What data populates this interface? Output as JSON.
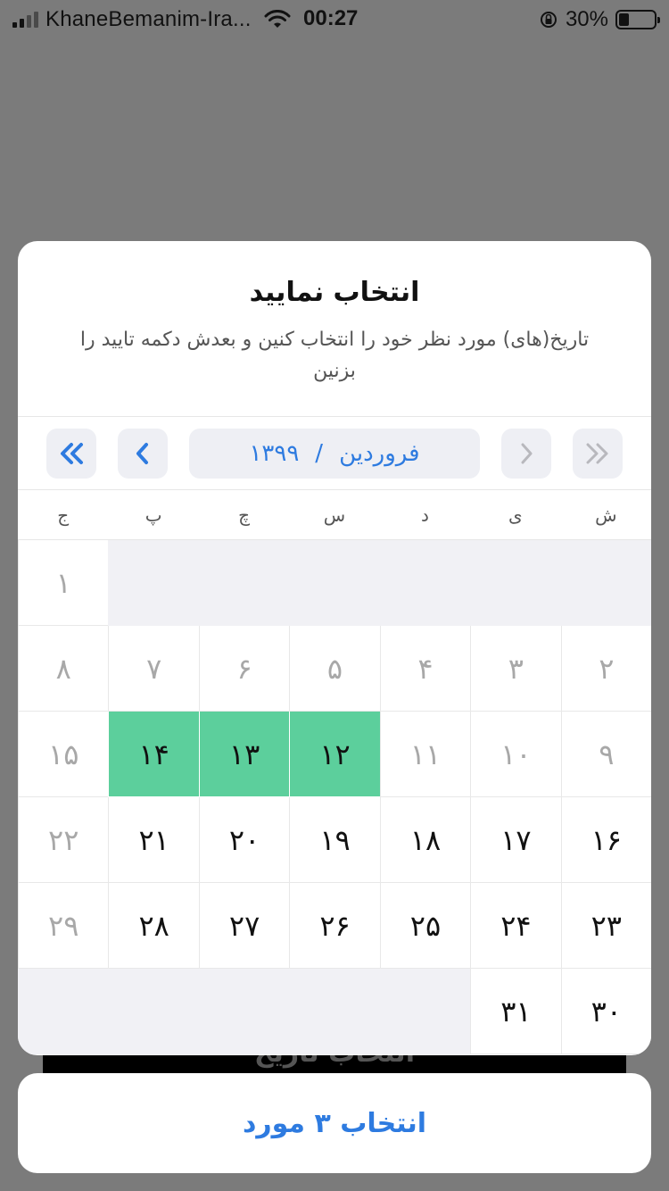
{
  "status_bar": {
    "carrier": "KhaneBemanim-Ira...",
    "time": "00:27",
    "battery": "30%",
    "battery_level": 0.3
  },
  "background": {
    "button_label": "انتخاب تاریخ"
  },
  "sheet": {
    "title": "انتخاب نمایید",
    "subtitle": "تاریخ(های) مورد نظر خود را انتخاب کنین و بعدش دکمه تایید را بزنین",
    "month": "فروردین",
    "separator": "/",
    "year": "۱۳۹۹",
    "nav": {
      "prev_year_icon": "double-chevron-right-icon",
      "prev_month_icon": "chevron-right-icon",
      "next_month_icon": "chevron-left-icon",
      "next_year_icon": "double-chevron-left-icon"
    },
    "weekdays": [
      "ش",
      "ی",
      "د",
      "س",
      "چ",
      "پ",
      "ج"
    ],
    "weeks": [
      [
        null,
        null,
        null,
        null,
        null,
        null,
        {
          "d": "۱",
          "muted": true
        }
      ],
      [
        {
          "d": "۲",
          "muted": true
        },
        {
          "d": "۳",
          "muted": true
        },
        {
          "d": "۴",
          "muted": true
        },
        {
          "d": "۵",
          "muted": true
        },
        {
          "d": "۶",
          "muted": true
        },
        {
          "d": "۷",
          "muted": true
        },
        {
          "d": "۸",
          "muted": true
        }
      ],
      [
        {
          "d": "۹",
          "muted": true
        },
        {
          "d": "۱۰",
          "muted": true
        },
        {
          "d": "۱۱",
          "muted": true
        },
        {
          "d": "۱۲",
          "selected": true
        },
        {
          "d": "۱۳",
          "selected": true
        },
        {
          "d": "۱۴",
          "selected": true
        },
        {
          "d": "۱۵",
          "muted": true
        }
      ],
      [
        {
          "d": "۱۶"
        },
        {
          "d": "۱۷"
        },
        {
          "d": "۱۸"
        },
        {
          "d": "۱۹"
        },
        {
          "d": "۲۰"
        },
        {
          "d": "۲۱"
        },
        {
          "d": "۲۲",
          "muted": true
        }
      ],
      [
        {
          "d": "۲۳"
        },
        {
          "d": "۲۴"
        },
        {
          "d": "۲۵"
        },
        {
          "d": "۲۶"
        },
        {
          "d": "۲۷"
        },
        {
          "d": "۲۸"
        },
        {
          "d": "۲۹",
          "muted": true
        }
      ],
      [
        {
          "d": "۳۰"
        },
        {
          "d": "۳۱"
        },
        null,
        null,
        null,
        null,
        null
      ]
    ],
    "colors": {
      "accent": "#2e7be0",
      "selected": "#5ccf9c",
      "muted": "#a8a8a8"
    }
  },
  "confirm": {
    "label": "انتخاب ۳ مورد"
  }
}
